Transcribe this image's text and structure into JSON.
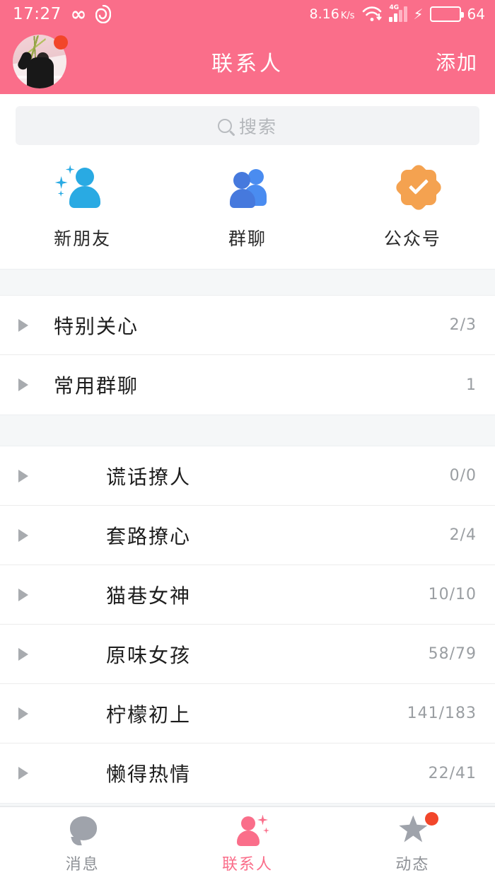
{
  "statusbar": {
    "time": "17:27",
    "infinity_icon": "infinity-icon",
    "app_icon": "shell-icon",
    "net_speed": "8.16",
    "net_speed_unit": "K/s",
    "wifi_icon": "wifi-download-icon",
    "network_type": "4G",
    "charging_icon": "charging-bolt-icon",
    "battery_percent": "64"
  },
  "header": {
    "title": "联系人",
    "action_label": "添加",
    "avatar_name": "user-avatar",
    "avatar_badge": "notification-dot"
  },
  "search": {
    "placeholder": "搜索",
    "icon": "search-icon"
  },
  "shortcuts": [
    {
      "label": "新朋友",
      "icon": "new-friend-icon",
      "color": "#29aae3"
    },
    {
      "label": "群聊",
      "icon": "group-chat-icon",
      "color": "#4679dd"
    },
    {
      "label": "公众号",
      "icon": "official-account-badge-icon",
      "color": "#f4a250"
    }
  ],
  "groups_primary": [
    {
      "name": "特别关心",
      "count": "2/3",
      "expand_icon": "chevron-right-icon"
    },
    {
      "name": "常用群聊",
      "count": "1",
      "expand_icon": "chevron-right-icon"
    }
  ],
  "groups_secondary": [
    {
      "name": "谎话撩人",
      "count": "0/0",
      "expand_icon": "chevron-right-icon"
    },
    {
      "name": "套路撩心",
      "count": "2/4",
      "expand_icon": "chevron-right-icon"
    },
    {
      "name": "猫巷女神",
      "count": "10/10",
      "expand_icon": "chevron-right-icon"
    },
    {
      "name": "原味女孩",
      "count": "58/79",
      "expand_icon": "chevron-right-icon"
    },
    {
      "name": "柠檬初上",
      "count": "141/183",
      "expand_icon": "chevron-right-icon"
    },
    {
      "name": "懒得热情",
      "count": "22/41",
      "expand_icon": "chevron-right-icon"
    }
  ],
  "tabs": [
    {
      "label": "消息",
      "icon": "message-bubble-icon",
      "active": false,
      "badge": false
    },
    {
      "label": "联系人",
      "icon": "contacts-person-icon",
      "active": true,
      "badge": false
    },
    {
      "label": "动态",
      "icon": "moments-star-icon",
      "active": false,
      "badge": true
    }
  ],
  "colors": {
    "accent_pink": "#fa6e8a",
    "badge_red": "#f2462a",
    "section_gap": "#f5f7f8",
    "muted_text": "#9a9ea2",
    "battery_green": "#2fd915"
  }
}
